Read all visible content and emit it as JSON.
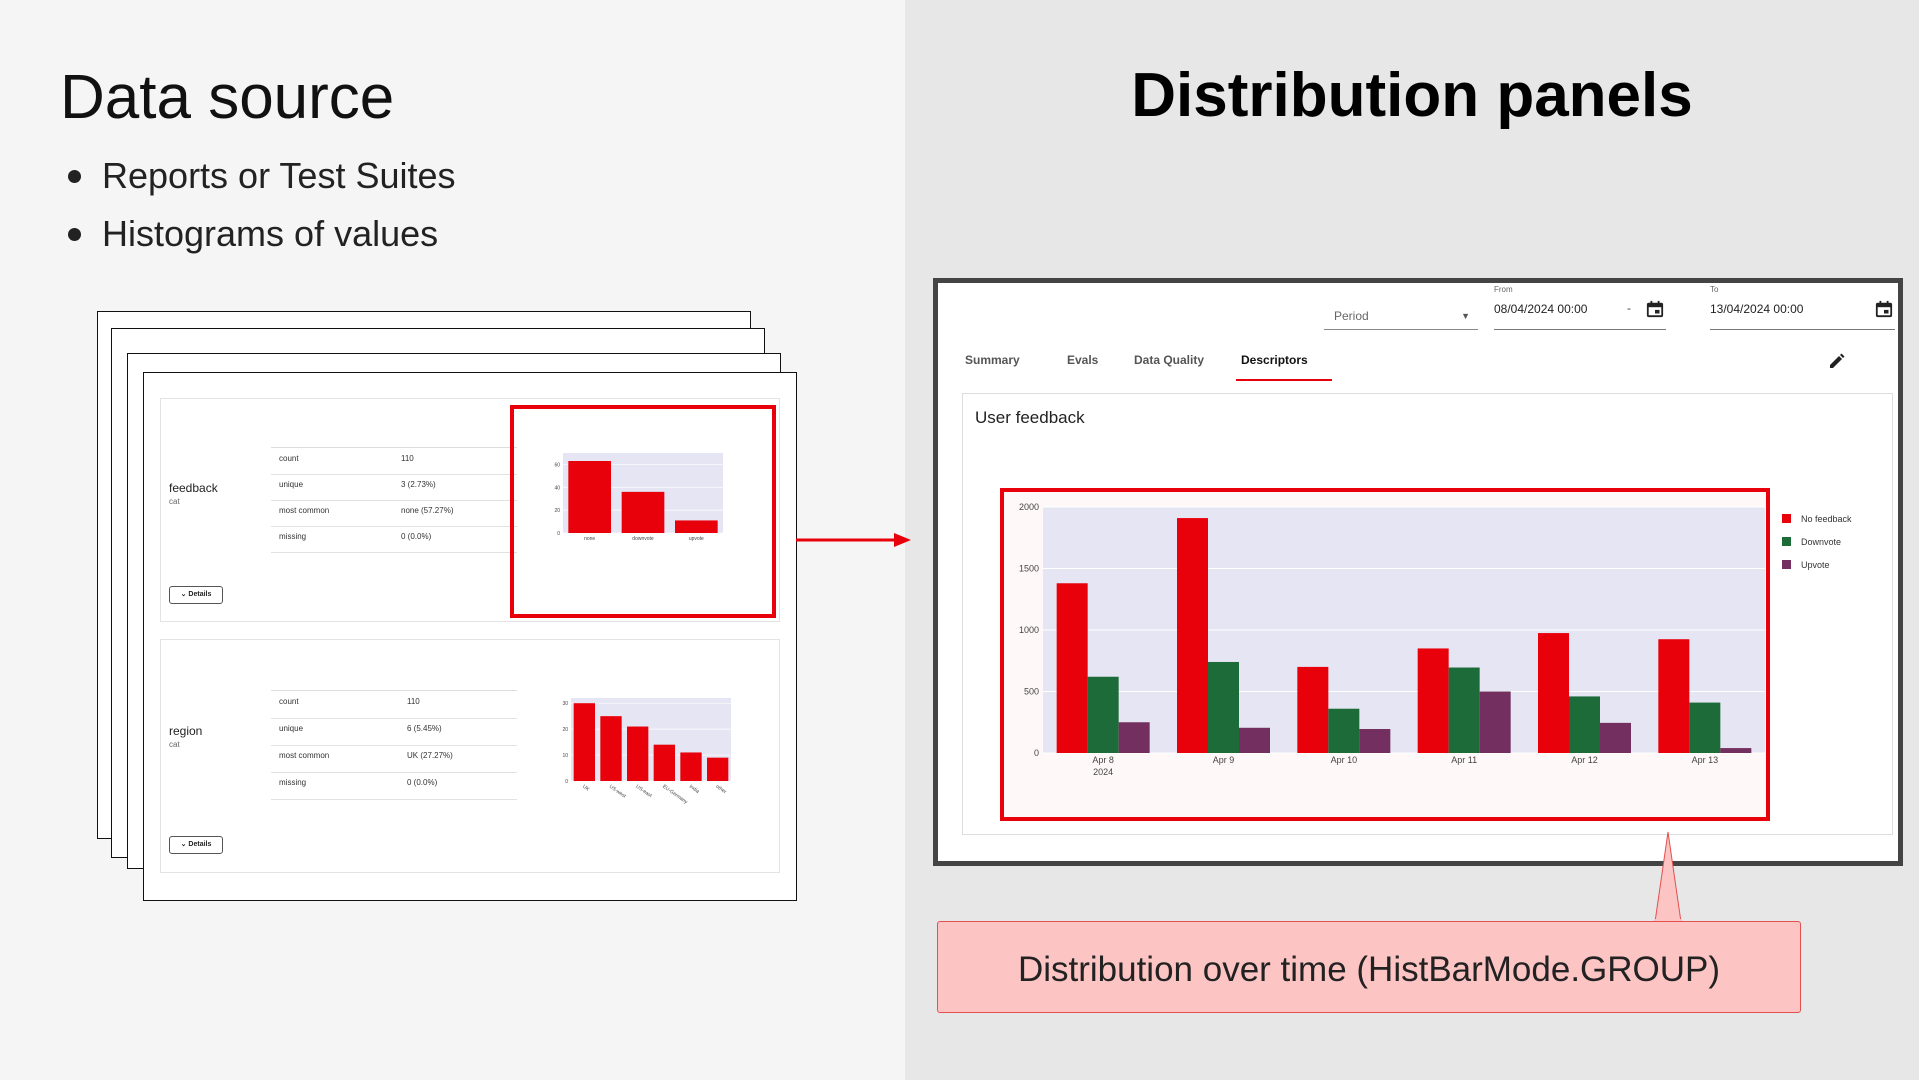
{
  "left": {
    "title": "Data source",
    "bullets": [
      "Reports or Test Suites",
      "Histograms of values"
    ]
  },
  "right": {
    "title": "Distribution panels"
  },
  "report": {
    "features": [
      {
        "name": "feedback",
        "type": "cat",
        "stats": [
          {
            "label": "count",
            "value": "110"
          },
          {
            "label": "unique",
            "value": "3 (2.73%)"
          },
          {
            "label": "most common",
            "value": "none (57.27%)"
          },
          {
            "label": "missing",
            "value": "0 (0.0%)"
          }
        ],
        "details_label": "Details"
      },
      {
        "name": "region",
        "type": "cat",
        "stats": [
          {
            "label": "count",
            "value": "110"
          },
          {
            "label": "unique",
            "value": "6 (5.45%)"
          },
          {
            "label": "most common",
            "value": "UK (27.27%)"
          },
          {
            "label": "missing",
            "value": "0 (0.0%)"
          }
        ],
        "details_label": "Details"
      }
    ]
  },
  "dashboard": {
    "period_label": "Period",
    "from_label": "From",
    "from_value": "08/04/2024 00:00",
    "to_label": "To",
    "to_value": "13/04/2024 00:00",
    "separator": "-",
    "tabs": [
      "Summary",
      "Evals",
      "Data Quality",
      "Descriptors"
    ],
    "active_tab": "Descriptors",
    "panel_title": "User feedback"
  },
  "callout": {
    "text": "Distribution over time (HistBarMode.GROUP)"
  },
  "colors": {
    "accent_red": "#e8000b",
    "green": "#1e6b3a",
    "purple": "#722f5f",
    "plot_bg": "#e5e5f3"
  },
  "chart_data": [
    {
      "type": "bar",
      "categories": [
        "none",
        "downvote",
        "upvote"
      ],
      "values": [
        63,
        36,
        11
      ],
      "ylim": [
        0,
        70
      ],
      "yticks": [
        0,
        20,
        40,
        60
      ]
    },
    {
      "type": "bar",
      "categories": [
        "UK",
        "US-west",
        "US-east",
        "EU-Germany",
        "India",
        "other"
      ],
      "values": [
        30,
        25,
        21,
        14,
        11,
        9
      ],
      "ylim": [
        0,
        32
      ],
      "yticks": [
        0,
        10,
        20,
        30
      ]
    },
    {
      "type": "bar",
      "categories": [
        "Apr 8",
        "Apr 9",
        "Apr 10",
        "Apr 11",
        "Apr 12",
        "Apr 13"
      ],
      "first_category_sublabel": "2024",
      "series": [
        {
          "name": "No feedback",
          "values": [
            1380,
            1910,
            700,
            850,
            975,
            925
          ]
        },
        {
          "name": "Downvote",
          "values": [
            620,
            740,
            360,
            695,
            460,
            410
          ]
        },
        {
          "name": "Upvote",
          "values": [
            250,
            205,
            195,
            500,
            245,
            40
          ]
        }
      ],
      "ylim": [
        0,
        2000
      ],
      "yticks": [
        0,
        500,
        1000,
        1500,
        2000
      ],
      "legend": "right"
    }
  ]
}
